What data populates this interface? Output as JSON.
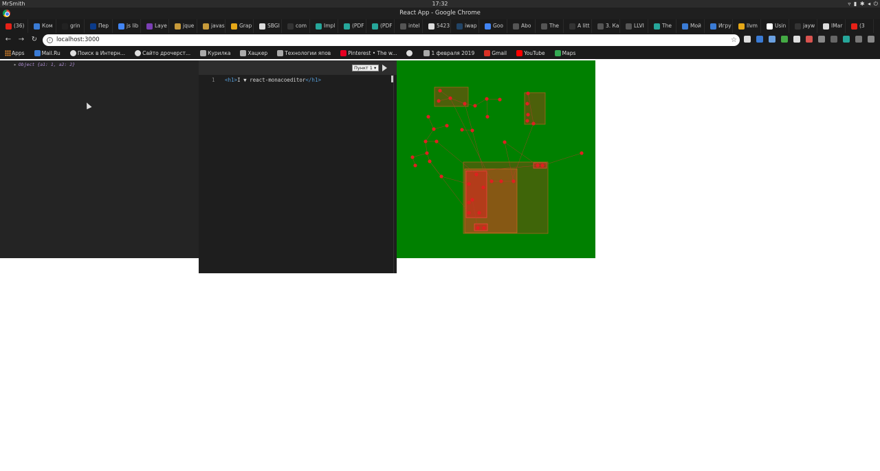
{
  "os": {
    "user": "MrSmith",
    "clock": "17:32",
    "tray_icons": [
      "wifi-icon",
      "battery-icon",
      "settings-icon",
      "volume-icon",
      "power-icon"
    ]
  },
  "window": {
    "title": "React App - Google Chrome"
  },
  "tabs": [
    {
      "label": "(36)",
      "color": "#e62117"
    },
    {
      "label": "Ком",
      "color": "#3a7bd5"
    },
    {
      "label": "grin",
      "color": "#222222"
    },
    {
      "label": "Пер",
      "color": "#0b3b8a"
    },
    {
      "label": "js lib",
      "color": "#4285f4"
    },
    {
      "label": "Laye",
      "color": "#7b3fb5"
    },
    {
      "label": "jque",
      "color": "#c79a3a"
    },
    {
      "label": "javas",
      "color": "#c79a3a"
    },
    {
      "label": "Grap",
      "color": "#e6a817"
    },
    {
      "label": "SBGI",
      "color": "#dddddd"
    },
    {
      "label": "com",
      "color": "#333333"
    },
    {
      "label": "Impl",
      "color": "#26a69a"
    },
    {
      "label": "(PDF",
      "color": "#26a69a"
    },
    {
      "label": "(PDF",
      "color": "#26a69a"
    },
    {
      "label": "intel",
      "color": "#555555"
    },
    {
      "label": "5423",
      "color": "#dddddd"
    },
    {
      "label": "iwap",
      "color": "#224466"
    },
    {
      "label": "Goo",
      "color": "#4285f4"
    },
    {
      "label": "Abo",
      "color": "#555555"
    },
    {
      "label": "The",
      "color": "#555555"
    },
    {
      "label": "A litt",
      "color": "#333333"
    },
    {
      "label": "3. Ка",
      "color": "#555555"
    },
    {
      "label": "LLVI",
      "color": "#555555"
    },
    {
      "label": "The",
      "color": "#26a69a"
    },
    {
      "label": "Мой",
      "color": "#3a7bd5"
    },
    {
      "label": "Игру",
      "color": "#3a7bd5"
    },
    {
      "label": "llvm",
      "color": "#e6a817"
    },
    {
      "label": "Usin",
      "color": "#ffffff"
    },
    {
      "label": "jayw",
      "color": "#333333"
    },
    {
      "label": "IMar",
      "color": "#dddddd"
    },
    {
      "label": "(3",
      "color": "#e62117"
    }
  ],
  "nav": {
    "url": "localhost:3000"
  },
  "extensions": [
    "#dddddd",
    "#3a7bd5",
    "#6aa0e0",
    "#44aa44",
    "#dddddd",
    "#d9534f",
    "#888888",
    "#666666",
    "#26a69a",
    "#777777",
    "#888888",
    "#777777"
  ],
  "bookmarks": [
    {
      "label": "Apps",
      "icon": "apps-grid-icon",
      "color": ""
    },
    {
      "label": "Mail.Ru",
      "icon": "mailru-icon",
      "color": "#3a7bd5"
    },
    {
      "label": "Поиск в Интерн...",
      "icon": "globe-icon",
      "color": "#dddddd"
    },
    {
      "label": "Сайто дрочерст...",
      "icon": "globe-icon",
      "color": "#dddddd"
    },
    {
      "label": "Курилка",
      "icon": "folder-icon",
      "color": "#aaaaaa"
    },
    {
      "label": "Хацкер",
      "icon": "folder-icon",
      "color": "#aaaaaa"
    },
    {
      "label": "Технологии япов",
      "icon": "folder-icon",
      "color": "#aaaaaa"
    },
    {
      "label": "Pinterest • The w...",
      "icon": "pinterest-icon",
      "color": "#e60023"
    },
    {
      "label": "",
      "icon": "globe-icon",
      "color": "#dddddd"
    },
    {
      "label": "1 февраля 2019",
      "icon": "folder-icon",
      "color": "#aaaaaa"
    },
    {
      "label": "Gmail",
      "icon": "gmail-icon",
      "color": "#d93025"
    },
    {
      "label": "YouTube",
      "icon": "youtube-icon",
      "color": "#ff0000"
    },
    {
      "label": "Maps",
      "icon": "maps-icon",
      "color": "#34a853"
    }
  ],
  "console": {
    "text": "Object {a1: 1, a2: 2}"
  },
  "editor": {
    "menu_selected": "Пункт 1 ▾",
    "line_number": "1",
    "code_open_tag": "<h1>",
    "code_text": "I ▼ react-monacoeditor",
    "code_close_tag": "</h1>"
  },
  "graph": {
    "background": "#008000",
    "node_color": "#e02020",
    "group_color": "#8b4513"
  }
}
